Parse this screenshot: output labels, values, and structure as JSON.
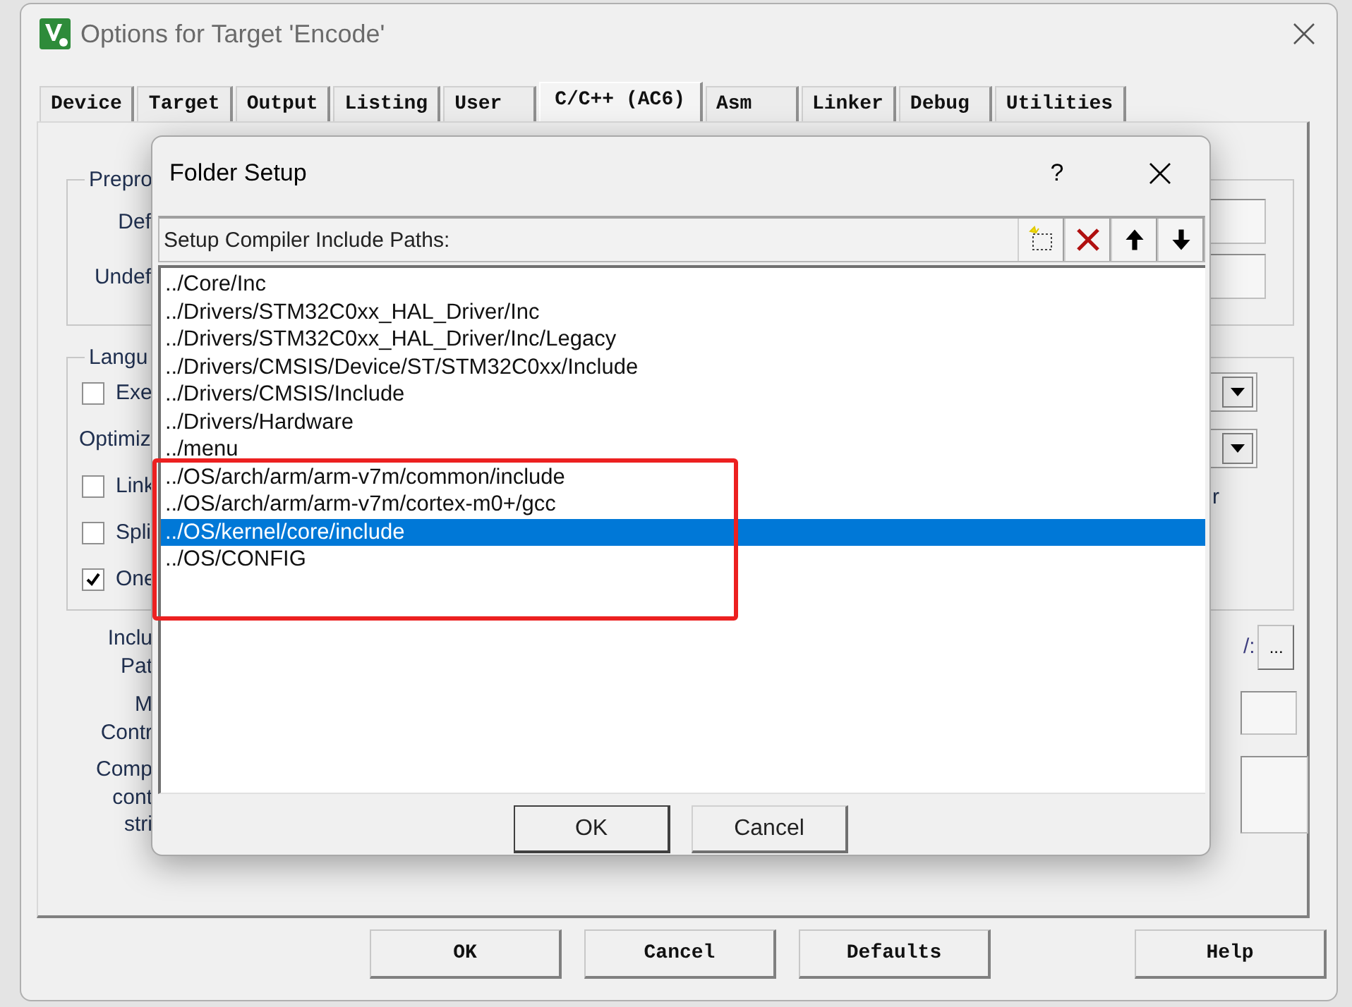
{
  "window": {
    "title": "Options for Target 'Encode'"
  },
  "tabs": [
    {
      "label": "Device",
      "selected": false
    },
    {
      "label": "Target",
      "selected": false
    },
    {
      "label": "Output",
      "selected": false
    },
    {
      "label": "Listing",
      "selected": false
    },
    {
      "label": "User",
      "selected": false
    },
    {
      "label": "C/C++ (AC6)",
      "selected": true
    },
    {
      "label": "Asm",
      "selected": false
    },
    {
      "label": "Linker",
      "selected": false
    },
    {
      "label": "Debug",
      "selected": false
    },
    {
      "label": "Utilities",
      "selected": false
    }
  ],
  "preprocessor_group": {
    "label": "Prepro",
    "fields": [
      {
        "label": "Def"
      },
      {
        "label": "Undef"
      }
    ]
  },
  "language_group": {
    "label": "Langu",
    "left_items": [
      {
        "kind": "checkbox",
        "label": "Exe",
        "checked": false
      },
      {
        "kind": "label",
        "label": "Optimiz"
      },
      {
        "kind": "checkbox",
        "label": "Link",
        "checked": false
      },
      {
        "kind": "checkbox",
        "label": "Spli",
        "checked": false
      },
      {
        "kind": "checkbox",
        "label": "One",
        "checked": true
      }
    ],
    "right_items": [
      {
        "kind": "dropdown"
      },
      {
        "kind": "dropdown"
      },
      {
        "kind": "text",
        "text": "r"
      }
    ]
  },
  "include_paths": {
    "label_lines": [
      "Inclu",
      "Pat"
    ],
    "text": "/:",
    "button": "..."
  },
  "misc_controls": {
    "label_lines": [
      "M",
      "Contr"
    ]
  },
  "compiler_control": {
    "label_lines": [
      "Comp",
      "cont",
      "stri"
    ]
  },
  "buttons": [
    "OK",
    "Cancel",
    "Defaults",
    "Help"
  ],
  "folder_setup": {
    "title": "Folder Setup",
    "help": "?",
    "list_title": "Setup Compiler Include Paths:",
    "paths": [
      {
        "text": "../Core/Inc",
        "selected": false
      },
      {
        "text": "../Drivers/STM32C0xx_HAL_Driver/Inc",
        "selected": false
      },
      {
        "text": "../Drivers/STM32C0xx_HAL_Driver/Inc/Legacy",
        "selected": false
      },
      {
        "text": "../Drivers/CMSIS/Device/ST/STM32C0xx/Include",
        "selected": false
      },
      {
        "text": "../Drivers/CMSIS/Include",
        "selected": false
      },
      {
        "text": "../Drivers/Hardware",
        "selected": false
      },
      {
        "text": "../menu",
        "selected": false
      },
      {
        "text": "../OS/arch/arm/arm-v7m/common/include",
        "selected": false
      },
      {
        "text": "../OS/arch/arm/arm-v7m/cortex-m0+/gcc",
        "selected": false
      },
      {
        "text": "../OS/kernel/core/include",
        "selected": true
      },
      {
        "text": "../OS/CONFIG",
        "selected": false
      }
    ],
    "buttons": [
      "OK",
      "Cancel"
    ]
  }
}
